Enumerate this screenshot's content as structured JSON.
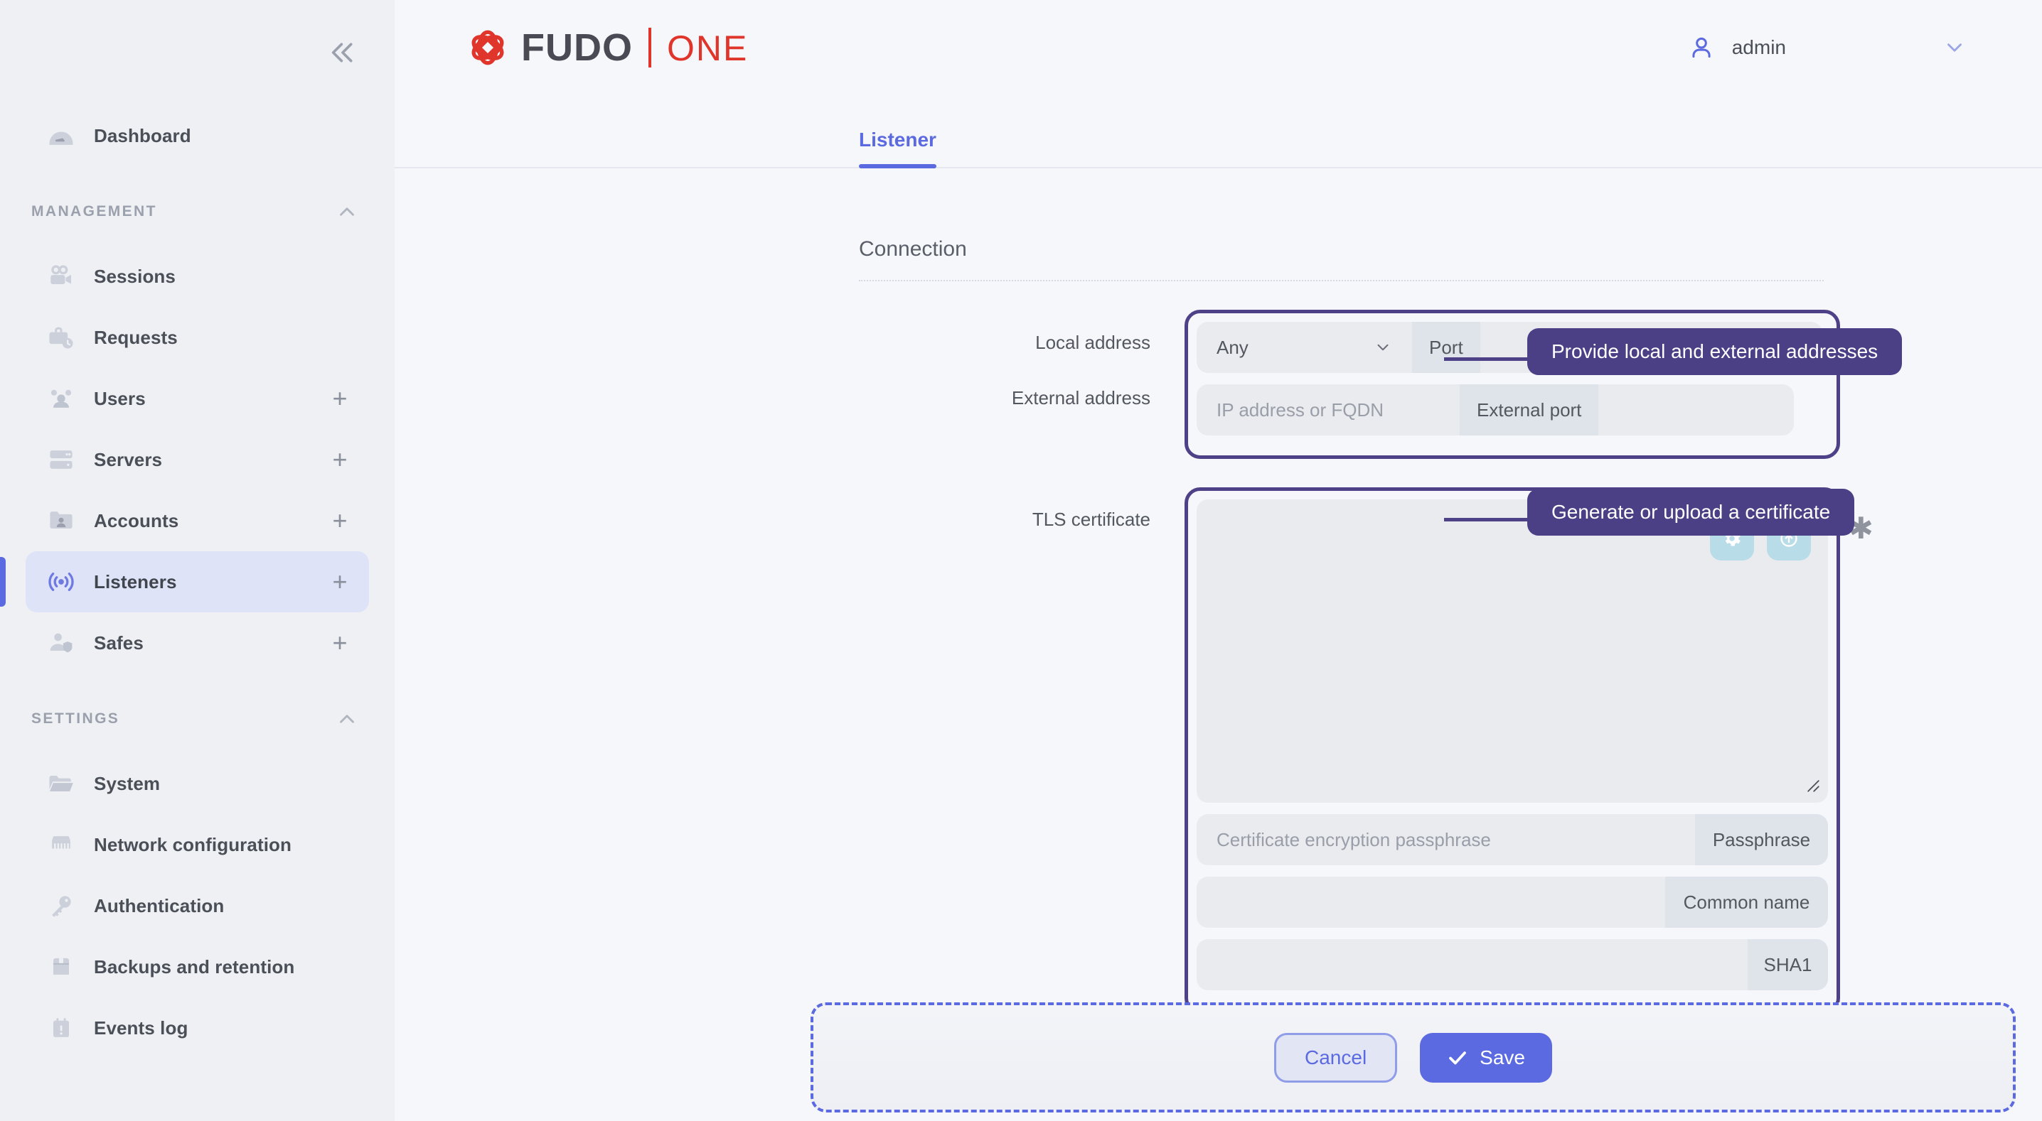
{
  "sidebar": {
    "collapse_icon": "chevron-double-left-icon",
    "top_items": [
      {
        "label": "Dashboard",
        "icon": "gauge-icon",
        "plus": false,
        "active": false
      }
    ],
    "groups": [
      {
        "title": "MANAGEMENT",
        "chevron": "chevron-up-icon",
        "items": [
          {
            "label": "Sessions",
            "icon": "video-camera-icon",
            "plus": false,
            "active": false
          },
          {
            "label": "Requests",
            "icon": "briefcase-clock-icon",
            "plus": false,
            "active": false
          },
          {
            "label": "Users",
            "icon": "users-icon",
            "plus": true,
            "active": false
          },
          {
            "label": "Servers",
            "icon": "server-icon",
            "plus": true,
            "active": false
          },
          {
            "label": "Accounts",
            "icon": "folder-user-icon",
            "plus": true,
            "active": false
          },
          {
            "label": "Listeners",
            "icon": "broadcast-icon",
            "plus": true,
            "active": true
          },
          {
            "label": "Safes",
            "icon": "user-shield-icon",
            "plus": true,
            "active": false
          }
        ]
      },
      {
        "title": "SETTINGS",
        "chevron": "chevron-up-icon",
        "items": [
          {
            "label": "System",
            "icon": "folder-open-icon",
            "plus": false,
            "active": false
          },
          {
            "label": "Network configuration",
            "icon": "network-port-icon",
            "plus": false,
            "active": false
          },
          {
            "label": "Authentication",
            "icon": "key-icon",
            "plus": false,
            "active": false
          },
          {
            "label": "Backups and retention",
            "icon": "archive-box-icon",
            "plus": false,
            "active": false
          },
          {
            "label": "Events log",
            "icon": "calendar-alert-icon",
            "plus": false,
            "active": false
          }
        ]
      }
    ],
    "plus_glyph": "+"
  },
  "topbar": {
    "logo_primary": "FUDO",
    "logo_secondary": "ONE",
    "logo_mark_icon": "fudo-knot-logo-icon",
    "user_icon": "user-avatar-icon",
    "user_name": "admin",
    "user_chevron_icon": "chevron-down-icon"
  },
  "tabs": [
    {
      "label": "Listener",
      "active": true
    }
  ],
  "main": {
    "section_title": "Connection",
    "required_marker": "✱",
    "fields": {
      "local_address": {
        "label": "Local address",
        "select_value": "Any",
        "select_caret_icon": "chevron-down-icon",
        "port_addon": "Port",
        "port_value": "",
        "port_placeholder": ""
      },
      "external_address": {
        "label": "External address",
        "host_value": "",
        "host_placeholder": "IP address or FQDN",
        "port_addon": "External port",
        "port_value": "",
        "port_placeholder": ""
      },
      "tls_certificate": {
        "label": "TLS certificate",
        "textarea_value": "",
        "textarea_placeholder": "",
        "generate_button_icon": "gear-icon",
        "upload_button_icon": "upload-circle-icon",
        "passphrase_placeholder": "Certificate encryption passphrase",
        "passphrase_value": "",
        "passphrase_addon": "Passphrase",
        "common_name_value": "",
        "common_name_addon": "Common name",
        "fingerprint_value": "",
        "fingerprint_addon": "SHA1"
      }
    }
  },
  "callouts": [
    {
      "text": "Provide local and external addresses"
    },
    {
      "text": "Generate or upload a certificate"
    }
  ],
  "footer": {
    "cancel_label": "Cancel",
    "save_label": "Save",
    "save_icon": "check-icon"
  },
  "colors": {
    "accent_blue": "#5b6ae0",
    "callout_purple": "#4b3f86",
    "brand_red": "#e0352b",
    "sidebar_bg": "#eff0f4",
    "field_bg": "#eaebef",
    "addon_bg": "#dfe3ea",
    "icon_btn_bg": "#b9dce9"
  }
}
